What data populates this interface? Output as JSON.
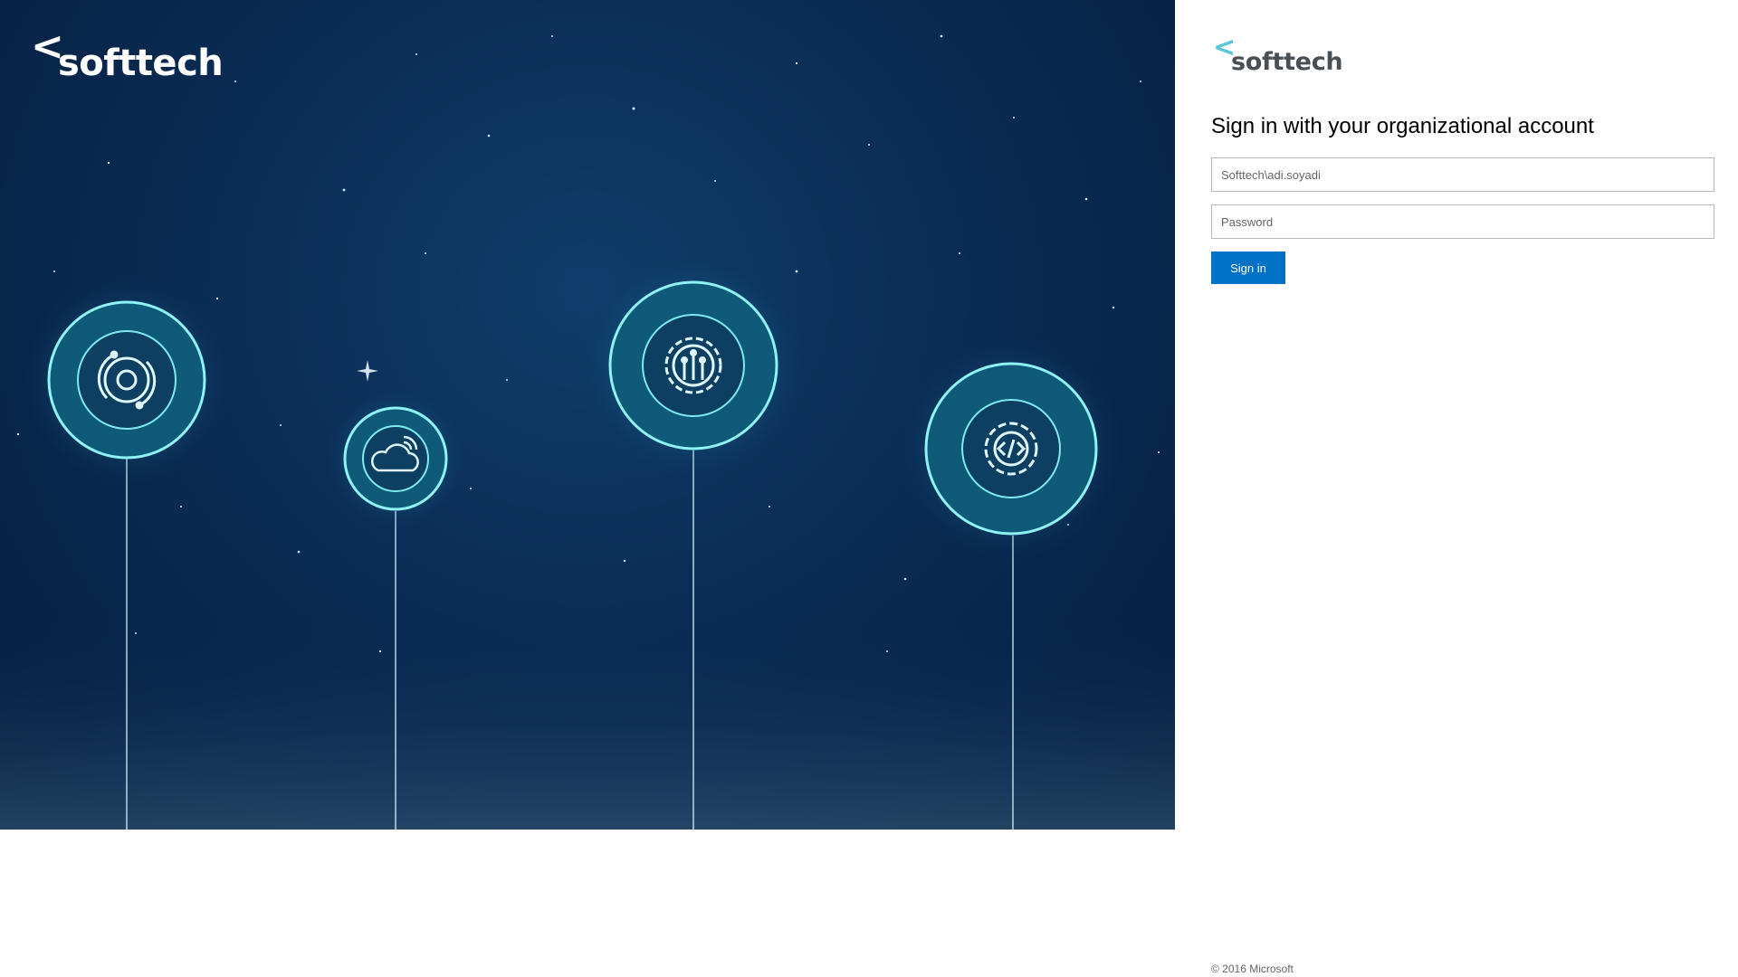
{
  "brand": {
    "chevron": "<",
    "name": "softtech",
    "accent_color": "#5bc8d8",
    "text_color": "#4a4f55"
  },
  "illustration": {
    "background_color": "#0a2c55",
    "glow_color": "#2fd6e0",
    "icons": [
      "gear-cycle-icon",
      "cloud-signal-icon",
      "gear-circuit-icon",
      "gear-code-icon"
    ]
  },
  "login": {
    "heading": "Sign in with your organizational account",
    "username_placeholder": "Softtech\\adi.soyadi",
    "password_placeholder": "Password",
    "signin_label": "Sign in",
    "button_color": "#0072c6"
  },
  "footer": {
    "copyright": "© 2016 Microsoft"
  }
}
